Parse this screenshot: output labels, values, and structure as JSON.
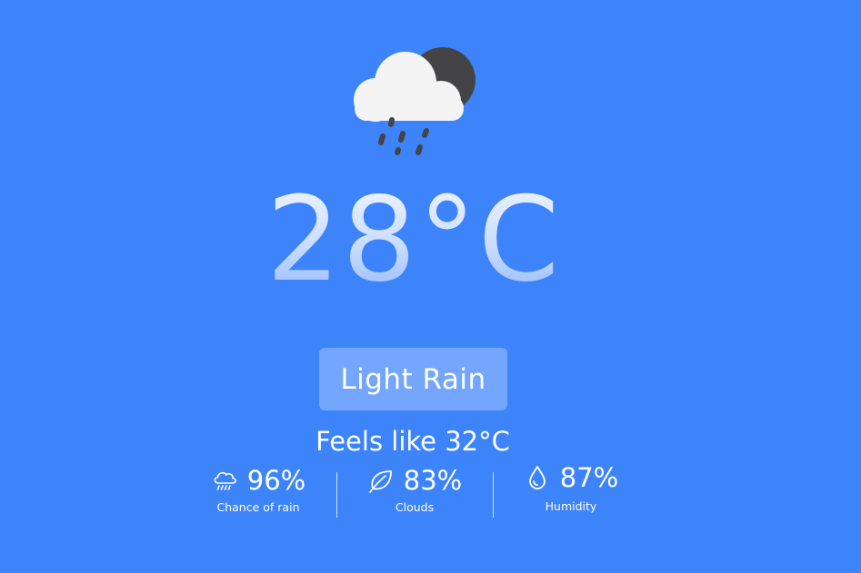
{
  "weather": {
    "icon": "rain-cloud-night-icon",
    "temperature": "28°C",
    "condition": "Light Rain",
    "feels_like": "Feels like 32°C"
  },
  "stats": [
    {
      "icon": "rain-cloud-icon",
      "value": "96%",
      "label": "Chance of rain"
    },
    {
      "icon": "leaf-icon",
      "value": "83%",
      "label": "Clouds"
    },
    {
      "icon": "water-drop-icon",
      "value": "87%",
      "label": "Humidity"
    }
  ],
  "colors": {
    "background": "#3d84fb",
    "cloud": "#f4f4f4",
    "moon": "#444446",
    "rain": "#444446",
    "text": "#ffffff"
  }
}
